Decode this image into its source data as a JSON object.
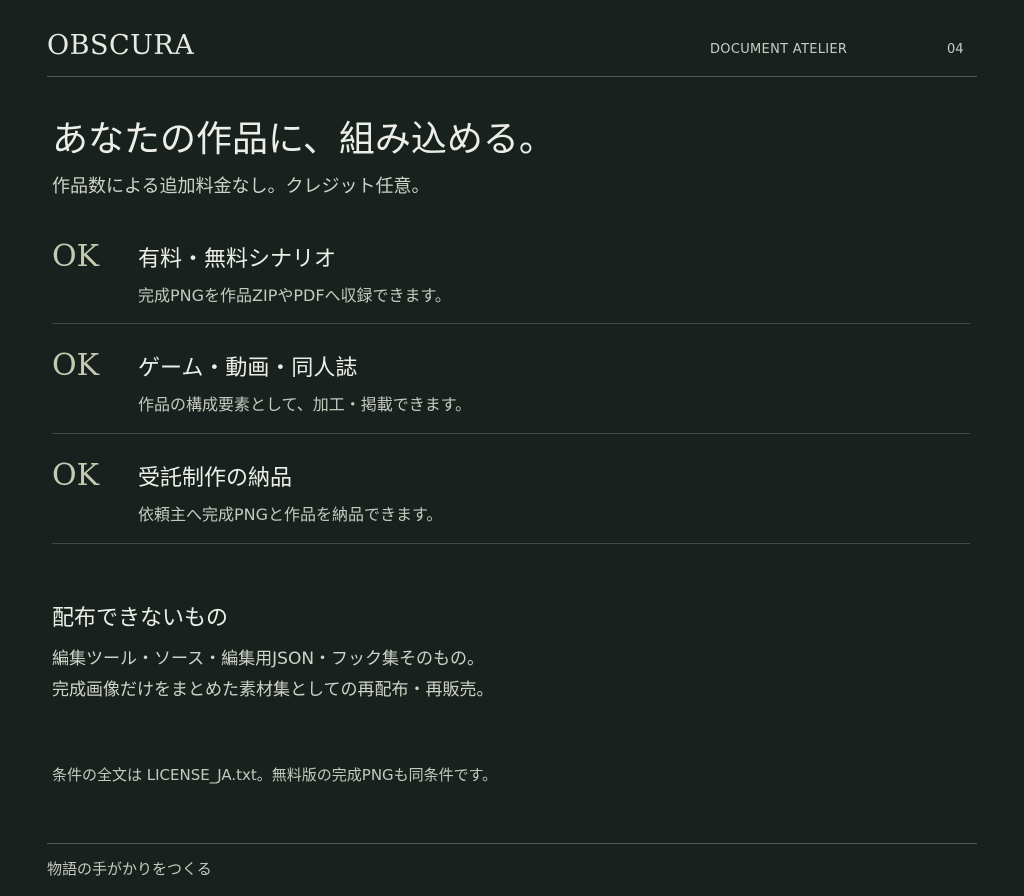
{
  "header": {
    "brand": "OBSCURA",
    "label": "DOCUMENT ATELIER",
    "page_number": "04"
  },
  "main": {
    "title": "あなたの作品に、組み込める。",
    "subtitle": "作品数による追加料金なし。クレジット任意。",
    "items": [
      {
        "badge": "OK",
        "heading": "有料・無料シナリオ",
        "description": "完成PNGを作品ZIPやPDFへ収録できます。"
      },
      {
        "badge": "OK",
        "heading": "ゲーム・動画・同人誌",
        "description": "作品の構成要素として、加工・掲載できます。"
      },
      {
        "badge": "OK",
        "heading": "受託制作の納品",
        "description": "依頼主へ完成PNGと作品を納品できます。"
      }
    ],
    "restrictions": {
      "heading": "配布できないもの",
      "lines": [
        "編集ツール・ソース・編集用JSON・フック集そのもの。",
        "完成画像だけをまとめた素材集としての再配布・再販売。"
      ]
    },
    "license_note": "条件の全文は LICENSE_JA.txt。無料版の完成PNGも同条件です。"
  },
  "footer": {
    "tagline": "物語の手がかりをつくる"
  },
  "colors": {
    "background": "#18211d",
    "accent": "#c5cab0",
    "rule": "#4f5e56"
  }
}
